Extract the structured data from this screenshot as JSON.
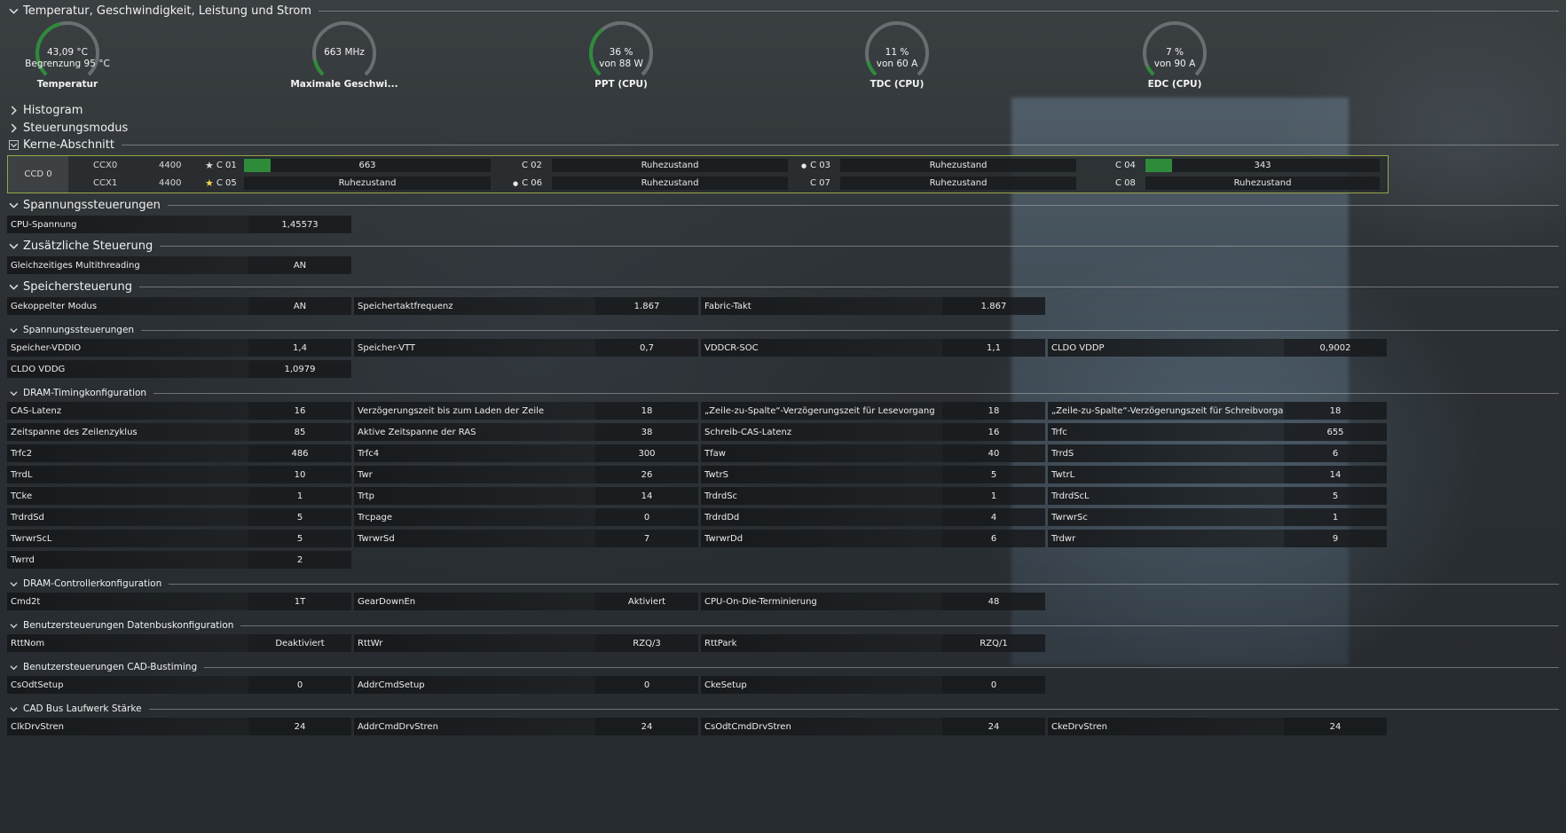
{
  "sections": {
    "temp": "Temperatur, Geschwindigkeit, Leistung und Strom",
    "histogram": "Histogram",
    "control_mode": "Steuerungsmodus",
    "cores": "Kerne-Abschnitt",
    "voltage": "Spannungssteuerungen",
    "additional": "Zusätzliche Steuerung",
    "memory": "Speichersteuerung",
    "mem_voltage": "Spannungssteuerungen",
    "dram_timing": "DRAM-Timingkonfiguration",
    "dram_controller": "DRAM-Controllerkonfiguration",
    "user_databus": "Benutzersteuerungen Datenbuskonfiguration",
    "user_cad": "Benutzersteuerungen CAD-Bustiming",
    "cad_drive": "CAD Bus Laufwerk Stärke"
  },
  "gauges": [
    {
      "v1": "43,09 °C",
      "v2": "Begrenzung  95 °C",
      "label": "Temperatur",
      "fraction": 0.45
    },
    {
      "v1": "663  MHz",
      "v2": "",
      "label": "Maximale Geschwi...",
      "fraction": 0.12
    },
    {
      "v1": "36 %",
      "v2": "von  88 W",
      "label": "PPT (CPU)",
      "fraction": 0.36
    },
    {
      "v1": "11 %",
      "v2": "von  60 A",
      "label": "TDC (CPU)",
      "fraction": 0.11
    },
    {
      "v1": "7 %",
      "v2": "von  90 A",
      "label": "EDC (CPU)",
      "fraction": 0.07
    }
  ],
  "cores": {
    "ccd": "CCD 0",
    "ccx": [
      {
        "name": "CCX0",
        "freq": "4400"
      },
      {
        "name": "CCX1",
        "freq": "4400"
      }
    ],
    "list": [
      {
        "name": "C 01",
        "value": "663",
        "marker": "star",
        "fill": 0.05
      },
      {
        "name": "C 02",
        "value": "Ruhezustand",
        "marker": "",
        "fill": 0
      },
      {
        "name": "C 03",
        "value": "Ruhezustand",
        "marker": "dot",
        "fill": 0
      },
      {
        "name": "C 04",
        "value": "343",
        "marker": "",
        "fill": 0.02
      },
      {
        "name": "C 05",
        "value": "Ruhezustand",
        "marker": "star",
        "fill": 0
      },
      {
        "name": "C 06",
        "value": "Ruhezustand",
        "marker": "dot",
        "fill": 0
      },
      {
        "name": "C 07",
        "value": "Ruhezustand",
        "marker": "",
        "fill": 0
      },
      {
        "name": "C 08",
        "value": "Ruhezustand",
        "marker": "",
        "fill": 0
      }
    ]
  },
  "voltage": {
    "cpu_label": "CPU-Spannung",
    "cpu_value": "1,45573"
  },
  "additional": {
    "smt_label": "Gleichzeitiges Multithreading",
    "smt_value": "AN"
  },
  "memory": [
    {
      "k": "Gekoppelter Modus",
      "v": "AN"
    },
    {
      "k": "Speichertaktfrequenz",
      "v": "1.867"
    },
    {
      "k": "Fabric-Takt",
      "v": "1.867"
    }
  ],
  "mem_voltage": [
    {
      "k": "Speicher-VDDIO",
      "v": "1,4"
    },
    {
      "k": "Speicher-VTT",
      "v": "0,7"
    },
    {
      "k": "VDDCR-SOC",
      "v": "1,1"
    },
    {
      "k": "CLDO VDDP",
      "v": "0,9002"
    },
    {
      "k": "CLDO VDDG",
      "v": "1,0979"
    }
  ],
  "dram_timing": [
    {
      "k": "CAS-Latenz",
      "v": "16"
    },
    {
      "k": "Verzögerungszeit bis zum Laden der Zeile",
      "v": "18"
    },
    {
      "k": "„Zeile-zu-Spalte“-Verzögerungszeit für Lesevorgang",
      "v": "18"
    },
    {
      "k": "„Zeile-zu-Spalte“-Verzögerungszeit für Schreibvorgang",
      "v": "18"
    },
    {
      "k": "Zeitspanne des Zeilenzyklus",
      "v": "85"
    },
    {
      "k": "Aktive Zeitspanne der RAS",
      "v": "38"
    },
    {
      "k": "Schreib-CAS-Latenz",
      "v": "16"
    },
    {
      "k": "Trfc",
      "v": "655"
    },
    {
      "k": "Trfc2",
      "v": "486"
    },
    {
      "k": "Trfc4",
      "v": "300"
    },
    {
      "k": "Tfaw",
      "v": "40"
    },
    {
      "k": "TrrdS",
      "v": "6"
    },
    {
      "k": "TrrdL",
      "v": "10"
    },
    {
      "k": "Twr",
      "v": "26"
    },
    {
      "k": "TwtrS",
      "v": "5"
    },
    {
      "k": "TwtrL",
      "v": "14"
    },
    {
      "k": "TCke",
      "v": "1"
    },
    {
      "k": "Trtp",
      "v": "14"
    },
    {
      "k": "TrdrdSc",
      "v": "1"
    },
    {
      "k": "TrdrdScL",
      "v": "5"
    },
    {
      "k": "TrdrdSd",
      "v": "5"
    },
    {
      "k": "Trcpage",
      "v": "0"
    },
    {
      "k": "TrdrdDd",
      "v": "4"
    },
    {
      "k": "TwrwrSc",
      "v": "1"
    },
    {
      "k": "TwrwrScL",
      "v": "5"
    },
    {
      "k": "TwrwrSd",
      "v": "7"
    },
    {
      "k": "TwrwrDd",
      "v": "6"
    },
    {
      "k": "Trdwr",
      "v": "9"
    },
    {
      "k": "Twrrd",
      "v": "2"
    }
  ],
  "dram_controller": [
    {
      "k": "Cmd2t",
      "v": "1T"
    },
    {
      "k": "GearDownEn",
      "v": "Aktiviert"
    },
    {
      "k": "CPU-On-Die-Terminierung",
      "v": "48"
    }
  ],
  "user_databus": [
    {
      "k": "RttNom",
      "v": "Deaktiviert"
    },
    {
      "k": "RttWr",
      "v": "RZQ/3"
    },
    {
      "k": "RttPark",
      "v": "RZQ/1"
    }
  ],
  "user_cad": [
    {
      "k": "CsOdtSetup",
      "v": "0"
    },
    {
      "k": "AddrCmdSetup",
      "v": "0"
    },
    {
      "k": "CkeSetup",
      "v": "0"
    }
  ],
  "cad_drive": [
    {
      "k": "ClkDrvStren",
      "v": "24"
    },
    {
      "k": "AddrCmdDrvStren",
      "v": "24"
    },
    {
      "k": "CsOdtCmdDrvStren",
      "v": "24"
    },
    {
      "k": "CkeDrvStren",
      "v": "24"
    }
  ],
  "colors": {
    "accent_green": "#2e8b3a",
    "gauge_bg": "#6a6e70",
    "core_border": "#9aa64a"
  }
}
